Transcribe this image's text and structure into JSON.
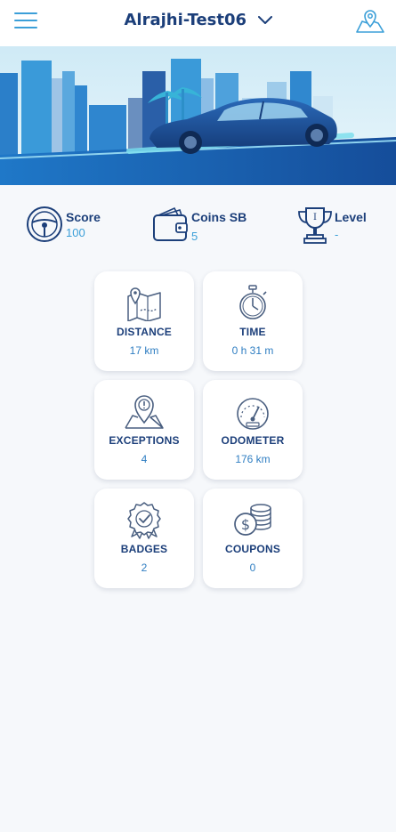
{
  "header": {
    "title": "Alrajhi-Test06"
  },
  "stats": [
    {
      "label": "Score",
      "value": "100",
      "icon": "steering-wheel-icon"
    },
    {
      "label": "Coins SB",
      "value": "5",
      "icon": "wallet-icon"
    },
    {
      "label": "Level",
      "value": "-",
      "icon": "trophy-icon"
    }
  ],
  "cards": [
    {
      "label": "DISTANCE",
      "value": "17 km",
      "icon": "map-pin-icon"
    },
    {
      "label": "TIME",
      "value": "0 h 31 m",
      "icon": "stopwatch-icon"
    },
    {
      "label": "EXCEPTIONS",
      "value": "4",
      "icon": "location-warning-icon"
    },
    {
      "label": "ODOMETER",
      "value": "176 km",
      "icon": "speedometer-icon"
    },
    {
      "label": "BADGES",
      "value": "2",
      "icon": "badge-icon"
    },
    {
      "label": "COUPONS",
      "value": "0",
      "icon": "coins-icon"
    }
  ],
  "colors": {
    "primary": "#1c3f7a",
    "accent": "#3b9fd8",
    "background": "#f6f8fb"
  }
}
